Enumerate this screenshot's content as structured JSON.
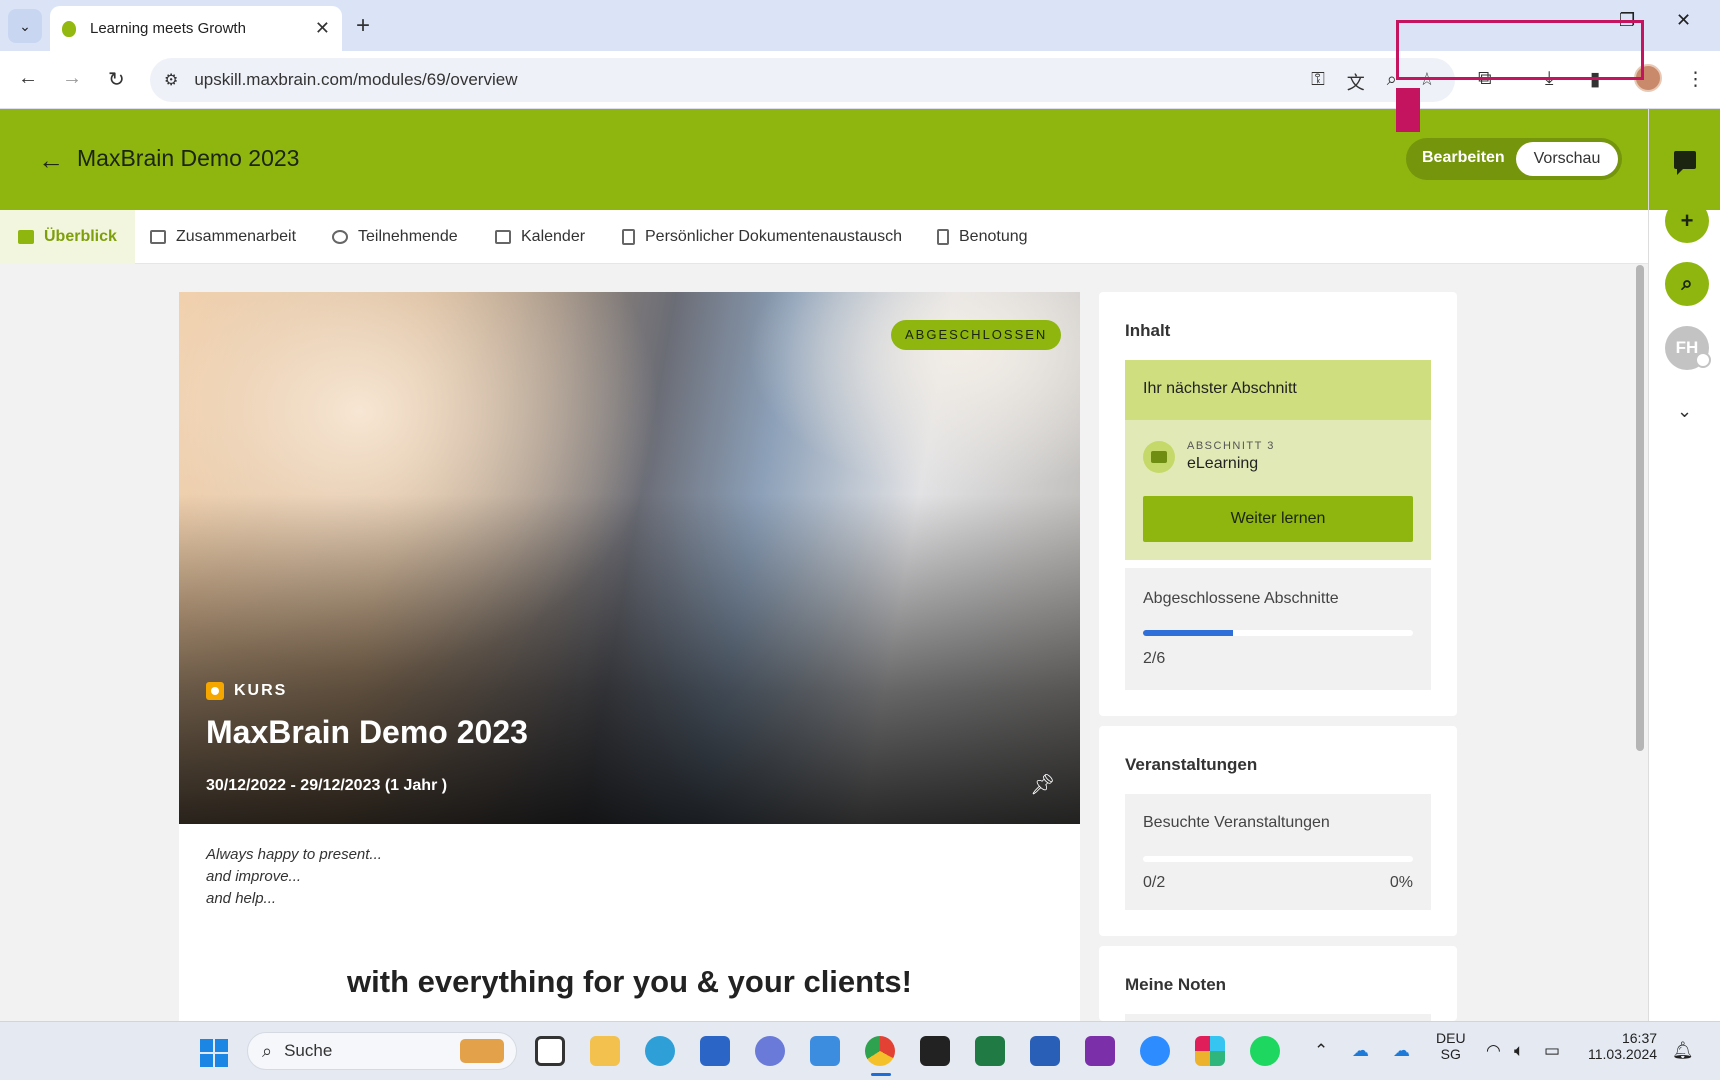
{
  "browser": {
    "tab_title": "Learning meets Growth",
    "new_tab_label": "+",
    "url": "upskill.maxbrain.com/modules/69/overview",
    "controls": {
      "minimize": "—",
      "restore": "❐",
      "close": "✕"
    }
  },
  "app": {
    "title": "MaxBrain Demo 2023",
    "mode_toggle": {
      "edit": "Bearbeiten",
      "preview": "Vorschau",
      "active": "preview"
    },
    "tabs": [
      {
        "label": "Überblick",
        "active": true
      },
      {
        "label": "Zusammenarbeit"
      },
      {
        "label": "Teilnehmende"
      },
      {
        "label": "Kalender"
      },
      {
        "label": "Persönlicher Dokumentenaustausch"
      },
      {
        "label": "Benotung"
      }
    ],
    "rail": {
      "avatar_initials": "FH"
    }
  },
  "hero": {
    "badge": "ABGESCHLOSSEN",
    "kind": "KURS",
    "title": "MaxBrain Demo 2023",
    "dates": "30/12/2022 - 29/12/2023 (1 Jahr )"
  },
  "description": {
    "lines": [
      "Always happy to present...",
      "and improve...",
      "and help..."
    ],
    "headline": "with everything for you & your clients!"
  },
  "inhalt": {
    "title": "Inhalt",
    "next_heading": "Ihr nächster Abschnitt",
    "next_section_label": "ABSCHNITT 3",
    "next_section_name": "eLearning",
    "continue_button": "Weiter lernen",
    "completed_label": "Abgeschlossene Abschnitte",
    "completed_value": "2/6",
    "completed_fraction": 0.333
  },
  "events": {
    "title": "Veranstaltungen",
    "visited_label": "Besuchte Veranstaltungen",
    "visited_value": "0/2",
    "visited_percent": "0%",
    "visited_fraction": 0
  },
  "grades": {
    "title": "Meine Noten"
  },
  "taskbar": {
    "search_placeholder": "Suche",
    "language": "DEU",
    "region": "SG",
    "time": "16:37",
    "date": "11.03.2024"
  },
  "colors": {
    "brand_green": "#8eb60f",
    "highlight_frame": "#c4135f",
    "progress_blue": "#2e6fd9"
  }
}
